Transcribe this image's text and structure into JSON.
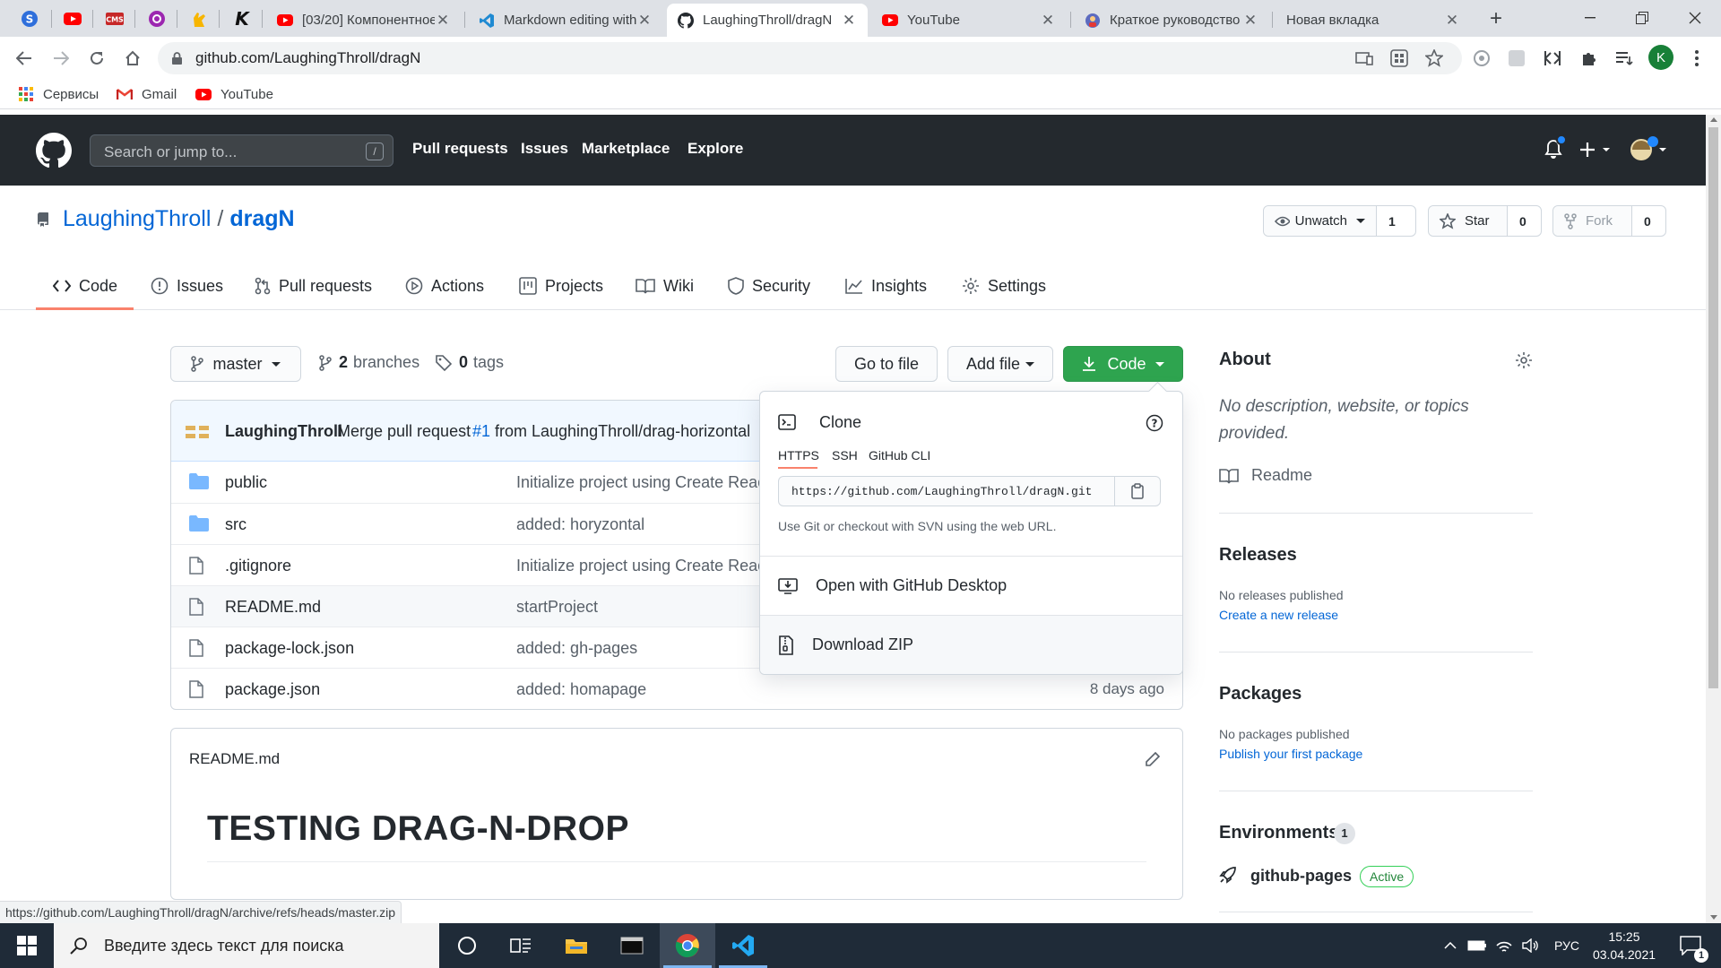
{
  "browser": {
    "tabs": [
      {
        "title": "[03/20] Компонентное",
        "icon": "youtube-icon",
        "active": false
      },
      {
        "title": "Markdown editing with",
        "icon": "vscode-icon",
        "active": false
      },
      {
        "title": "LaughingThroll/dragN",
        "icon": "github-icon",
        "active": true
      },
      {
        "title": "YouTube",
        "icon": "youtube-icon",
        "active": false
      },
      {
        "title": "Краткое руководство",
        "icon": "guide-icon",
        "active": false
      },
      {
        "title": "Новая вкладка",
        "icon": "",
        "active": false
      }
    ],
    "url": "github.com/LaughingThroll/dragN",
    "profile_initial": "K",
    "bookmarks": [
      {
        "label": "Сервисы",
        "icon": "apps-grid-icon"
      },
      {
        "label": "Gmail",
        "icon": "gmail-icon"
      },
      {
        "label": "YouTube",
        "icon": "youtube-icon"
      }
    ]
  },
  "gh": {
    "search_placeholder": "Search or jump to...",
    "search_key": "/",
    "nav": [
      "Pull requests",
      "Issues",
      "Marketplace",
      "Explore"
    ]
  },
  "repo": {
    "owner": "LaughingThroll",
    "sep": "/",
    "name": "dragN",
    "watch": {
      "label": "Unwatch",
      "count": "1"
    },
    "star": {
      "label": "Star",
      "count": "0"
    },
    "fork": {
      "label": "Fork",
      "count": "0"
    },
    "tabs": [
      "Code",
      "Issues",
      "Pull requests",
      "Actions",
      "Projects",
      "Wiki",
      "Security",
      "Insights",
      "Settings"
    ],
    "branch": "master",
    "branches_count": "2",
    "branches_label": "branches",
    "tags_count": "0",
    "tags_label": "tags",
    "go_to_file": "Go to file",
    "add_file": "Add file",
    "code_btn": "Code"
  },
  "commit": {
    "author": "LaughingThroll",
    "msg_pre": "Merge pull request",
    "pr": "#1",
    "msg_post": "from LaughingThroll/drag-horizontal"
  },
  "files": [
    {
      "name": "public",
      "type": "dir",
      "message": "Initialize project using Create React App",
      "age": ""
    },
    {
      "name": "src",
      "type": "dir",
      "message": "added: horyzontal",
      "age": ""
    },
    {
      "name": ".gitignore",
      "type": "file",
      "message": "Initialize project using Create React App",
      "age": ""
    },
    {
      "name": "README.md",
      "type": "file",
      "message": "startProject",
      "age": ""
    },
    {
      "name": "package-lock.json",
      "type": "file",
      "message": "added: gh-pages",
      "age": ""
    },
    {
      "name": "package.json",
      "type": "file",
      "message": "added: homapage",
      "age": "8 days ago"
    }
  ],
  "readme": {
    "filename": "README.md",
    "heading": "TESTING DRAG-N-DROP"
  },
  "clone": {
    "title": "Clone",
    "tabs": [
      "HTTPS",
      "SSH",
      "GitHub CLI"
    ],
    "url": "https://github.com/LaughingThroll/dragN.git",
    "hint": "Use Git or checkout with SVN using the web URL.",
    "desktop": "Open with GitHub Desktop",
    "zip": "Download ZIP"
  },
  "sidebar": {
    "about_title": "About",
    "about_text": "No description, website, or topics provided.",
    "readme_link": "Readme",
    "releases_title": "Releases",
    "releases_text": "No releases published",
    "releases_link": "Create a new release",
    "packages_title": "Packages",
    "packages_text": "No packages published",
    "packages_link": "Publish your first package",
    "env_title": "Environments",
    "env_count": "1",
    "env_name": "github-pages",
    "env_status": "Active"
  },
  "status_url": "https://github.com/LaughingThroll/dragN/archive/refs/heads/master.zip",
  "taskbar": {
    "search_placeholder": "Введите здесь текст для поиска",
    "lang": "РУС",
    "time": "15:25",
    "date": "03.04.2021",
    "notif_count": "1"
  },
  "colors": {
    "accent_green": "#2ea44f",
    "link_blue": "#0366d6",
    "tab_underline": "#f9826c",
    "gh_header": "#24292e"
  }
}
